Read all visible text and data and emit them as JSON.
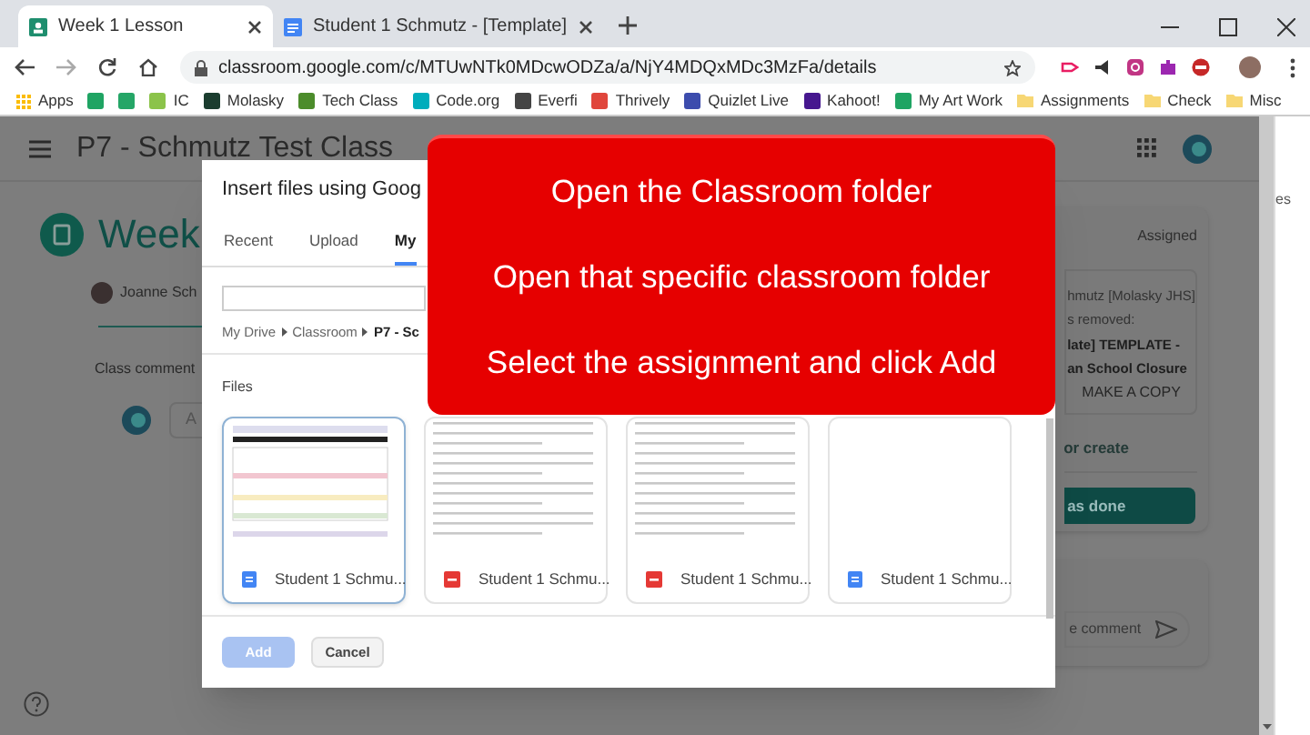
{
  "browser": {
    "tabs": [
      {
        "title": "Week 1 Lesson",
        "selected": true
      },
      {
        "title": "Student 1 Schmutz - [Template]",
        "selected": false
      }
    ],
    "url": "classroom.google.com/c/MTUwNTk0MDcwODZa/a/NjY4MDQxMDc3MzFa/details",
    "bookmarks": [
      {
        "kind": "apps",
        "label": "Apps"
      },
      {
        "kind": "site",
        "color": "#1fa463"
      },
      {
        "kind": "site",
        "color": "#25a667"
      },
      {
        "kind": "site",
        "label": "IC",
        "color": "#8bc34a"
      },
      {
        "kind": "site",
        "label": "Molasky",
        "color": "#1b3d2f"
      },
      {
        "kind": "site",
        "label": "Tech Class",
        "color": "#4c8c2b"
      },
      {
        "kind": "site",
        "label": "Code.org",
        "color": "#00adbc"
      },
      {
        "kind": "site",
        "label": "Everfi",
        "color": "#444444"
      },
      {
        "kind": "site",
        "label": "Thrively",
        "color": "#e0463c"
      },
      {
        "kind": "site",
        "label": "Quizlet Live",
        "color": "#3c4cad"
      },
      {
        "kind": "site",
        "label": "Kahoot!",
        "color": "#46178f"
      },
      {
        "kind": "site",
        "label": "My Art Work",
        "color": "#1fa463"
      },
      {
        "kind": "folder",
        "label": "Assignments"
      },
      {
        "kind": "folder",
        "label": "Check"
      },
      {
        "kind": "folder",
        "label": "Misc"
      }
    ]
  },
  "page": {
    "class_title": "P7 - Schmutz Test Class",
    "assignment_title": "Week",
    "author": "Joanne Sch",
    "class_comments": "Class comment",
    "comment_initial": "A",
    "status": "Assigned",
    "attachment_lines": [
      "hmutz [Molasky JHS]",
      "s removed:",
      "late] TEMPLATE -",
      "an School Closure"
    ],
    "make_copy": "MAKE A COPY",
    "add_or_create": "or create",
    "mark_done": "as done",
    "comment_placeholder": "e comment",
    "side_text": "es"
  },
  "dialog": {
    "title": "Insert files using Goog",
    "tabs": [
      {
        "label": "Recent",
        "selected": false
      },
      {
        "label": "Upload",
        "selected": false
      },
      {
        "label": "My",
        "selected": true
      }
    ],
    "breadcrumb": [
      "My Drive",
      "Classroom",
      "P7 - Sc"
    ],
    "section": "Files",
    "files": [
      {
        "name": "Student 1 Schmu...",
        "kind": "doc",
        "selected": true
      },
      {
        "name": "Student 1 Schmu...",
        "kind": "pdf",
        "selected": false
      },
      {
        "name": "Student 1 Schmu...",
        "kind": "pdf",
        "selected": false
      },
      {
        "name": "Student 1 Schmu...",
        "kind": "doc",
        "selected": false
      }
    ],
    "buttons": [
      {
        "label": "Add",
        "kind": "primary",
        "disabled": true
      },
      {
        "label": "Cancel",
        "kind": "secondary",
        "disabled": false
      }
    ]
  },
  "overlay": {
    "lines": [
      "Open the Classroom folder",
      "Open that specific classroom folder",
      "Select the assignment and click Add"
    ]
  }
}
